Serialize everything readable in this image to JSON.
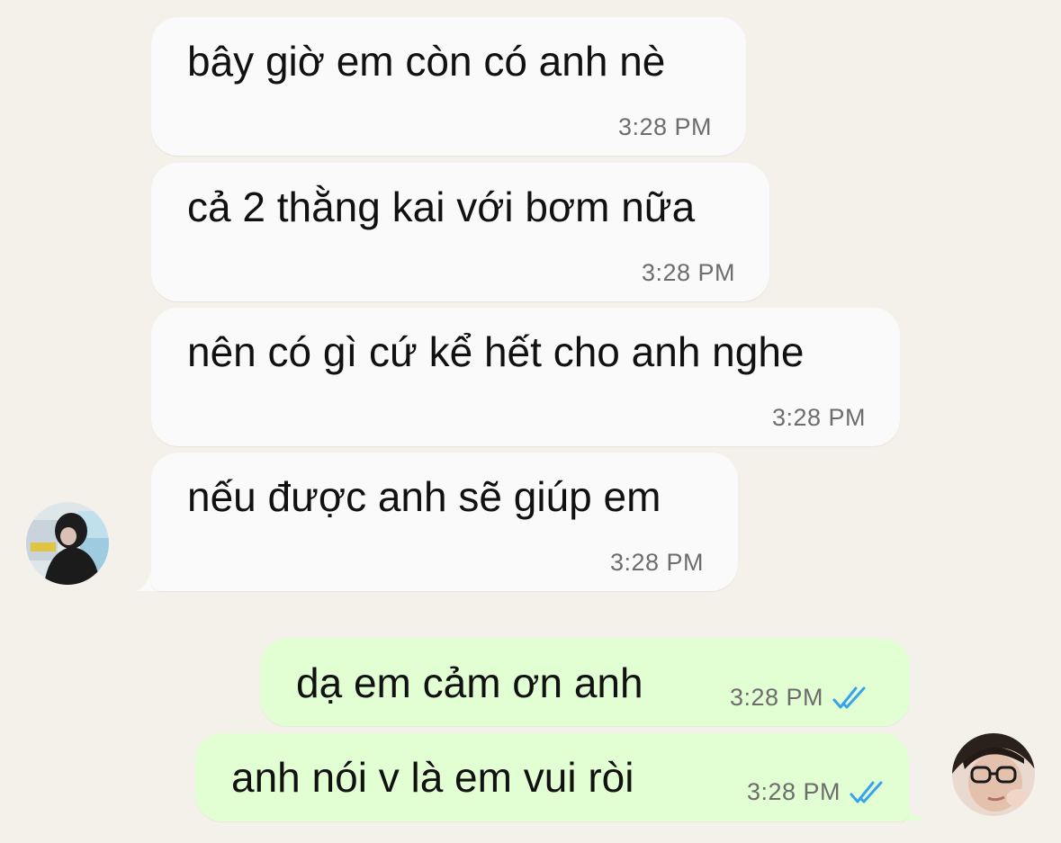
{
  "chat": {
    "incoming": [
      {
        "text": "bây giờ em còn có anh nè",
        "time": "3:28 PM"
      },
      {
        "text": "cả 2 thằng kai với bơm nữa",
        "time": "3:28 PM"
      },
      {
        "text": "nên có gì cứ kể hết cho anh nghe",
        "time": "3:28 PM"
      },
      {
        "text": "nếu được anh sẽ giúp em",
        "time": "3:28 PM"
      }
    ],
    "outgoing": [
      {
        "text": "dạ em cảm ơn anh",
        "time": "3:28 PM",
        "status": "double-check-read"
      },
      {
        "text": "anh nói v là em vui ròi",
        "time": "3:28 PM",
        "status": "double-check-read"
      }
    ]
  },
  "colors": {
    "background": "#f4f1eb",
    "incoming_bubble": "#fafafa",
    "outgoing_bubble": "#e2ffd4",
    "read_tick": "#39a3ea",
    "time_text": "#6d6d6d"
  },
  "icons": {
    "contact_avatar": "contact-avatar",
    "my_avatar": "my-avatar",
    "read_receipt": "double-check-icon"
  }
}
